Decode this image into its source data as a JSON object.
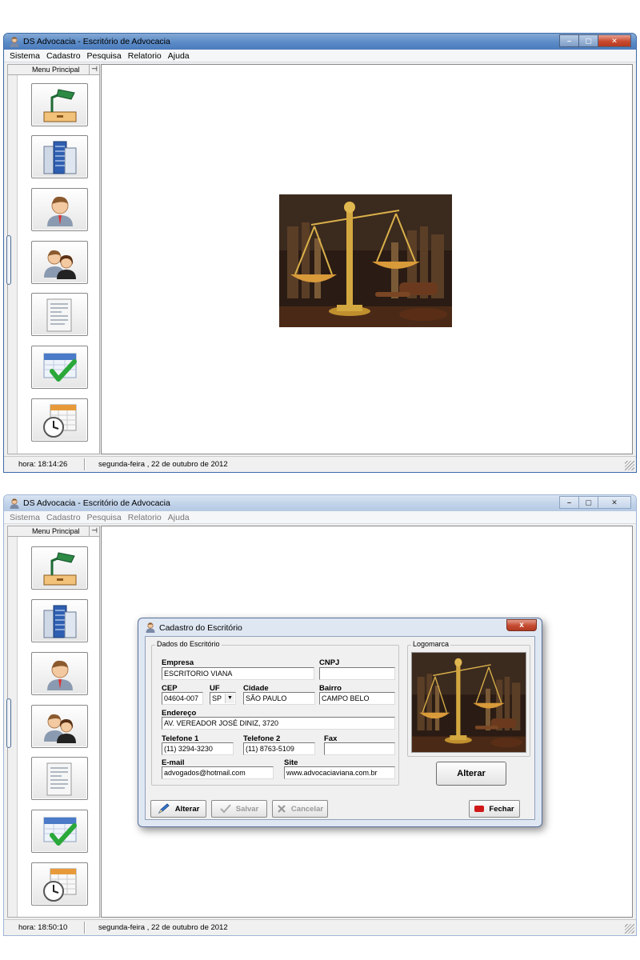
{
  "app": {
    "title": "DS Advocacia - Escritório de Advocacia",
    "menu": [
      "Sistema",
      "Cadastro",
      "Pesquisa",
      "Relatorio",
      "Ajuda"
    ],
    "sidebar_title": "Menu Principal",
    "sidebar_pin": "⊣",
    "sidebar_buttons": [
      "desk-lamp-icon",
      "buildings-icon",
      "user-icon",
      "users-icon",
      "document-icon",
      "calendar-check-icon",
      "calendar-clock-icon"
    ]
  },
  "window1": {
    "status_time": "hora:  18:14:26",
    "status_date": "segunda-feira ,  22 de outubro de 2012"
  },
  "window2": {
    "status_time": "hora:  18:50:10",
    "status_date": "segunda-feira ,  22 de outubro de 2012"
  },
  "dialog": {
    "title": "Cadastro do Escritório",
    "close": "x",
    "group_dados": "Dados do Escritório",
    "group_logo": "Logomarca",
    "labels": {
      "empresa": "Empresa",
      "cnpj": "CNPJ",
      "cep": "CEP",
      "uf": "UF",
      "cidade": "Cidade",
      "bairro": "Bairro",
      "endereco": "Endereço",
      "telefone1": "Telefone 1",
      "telefone2": "Telefone 2",
      "fax": "Fax",
      "email": "E-mail",
      "site": "Site"
    },
    "values": {
      "empresa": "ESCRITORIO VIANA",
      "cnpj": "",
      "cep": "04604-007",
      "uf": "SP",
      "cidade": "SÃO PAULO",
      "bairro": "CAMPO BELO",
      "endereco": "AV. VEREADOR JOSÉ DINIZ, 3720",
      "telefone1": "(11) 3294-3230",
      "telefone2": "(11) 8763-5109",
      "fax": "",
      "email": "advogados@hotmail.com",
      "site": "www.advocaciaviana.com.br"
    },
    "logo_button": "Alterar",
    "footer": {
      "alterar": "Alterar",
      "salvar": "Salvar",
      "cancelar": "Cancelar",
      "fechar": "Fechar"
    }
  },
  "colors": {
    "titlebar_active": "#5b8bc7",
    "close_red": "#c44a2f",
    "dialog_frame": "#dfe7f2"
  }
}
